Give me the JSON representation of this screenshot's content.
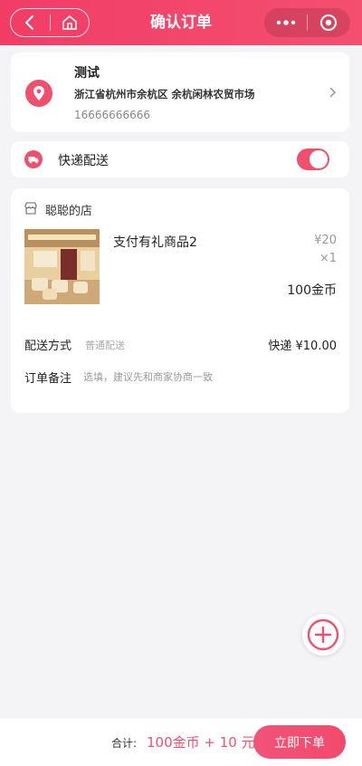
{
  "header": {
    "title": "确认订单",
    "back_icon": "back-icon",
    "home_icon": "home-icon"
  },
  "address": {
    "name": "测试",
    "detail": "浙江省杭州市余杭区 余杭闲林农贸市场",
    "phone": "16666666666"
  },
  "delivery": {
    "label": "快递配送",
    "enabled": true
  },
  "shop": {
    "name": "聪聪的店"
  },
  "product": {
    "name": "支付有礼商品2",
    "price": "¥20",
    "quantity": "×1",
    "coins": "100金币"
  },
  "shipping": {
    "label": "配送方式",
    "method": "普通配送",
    "fee": "快递 ¥10.00"
  },
  "remark": {
    "label": "订单备注",
    "placeholder": "选填，建议先和商家协商一致"
  },
  "footer": {
    "total_label": "合计:",
    "total_value": "100金币 + 10 元",
    "submit_label": "立即下单"
  },
  "colors": {
    "accent": "#f14f6e",
    "background": "#f4f3f6"
  }
}
